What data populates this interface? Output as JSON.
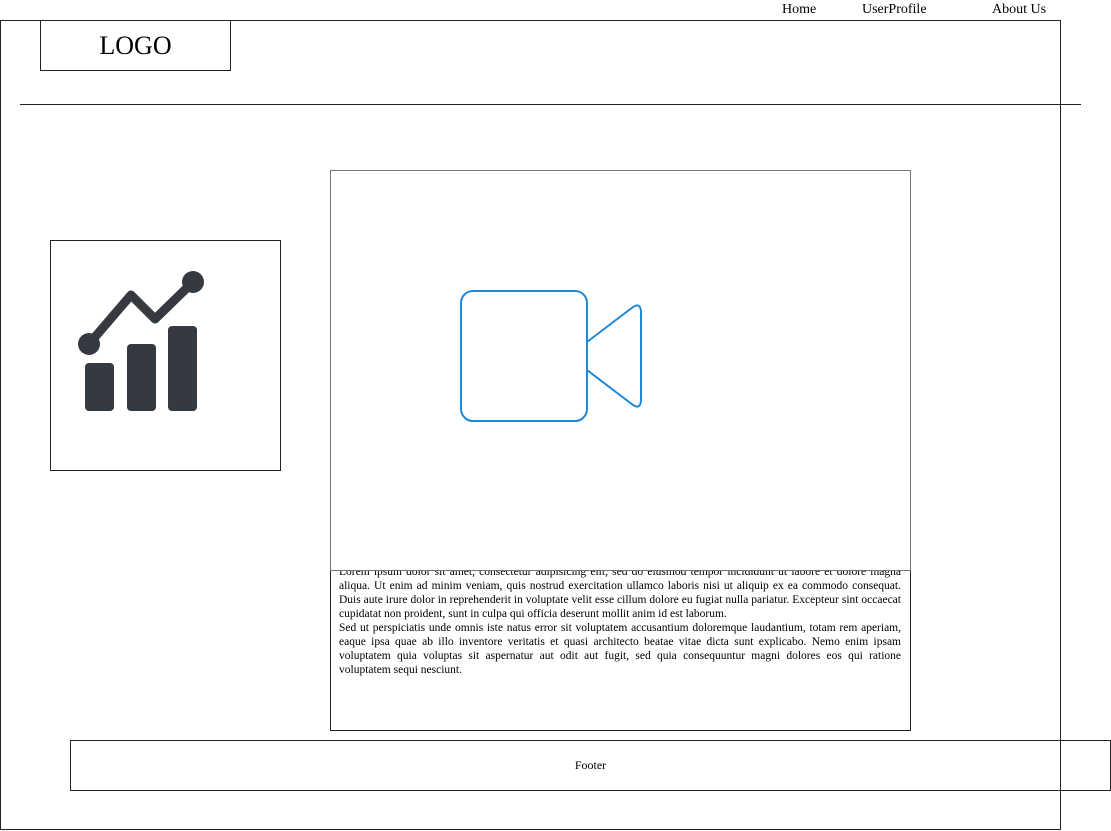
{
  "nav": {
    "home": "Home",
    "profile": "UserProfile",
    "about": "About Us"
  },
  "header": {
    "logo": "LOGO"
  },
  "main": {
    "chart_icon": "chart-growth-icon",
    "video_icon": "video-camera-icon",
    "paragraph_1": "Lorem ipsum dolor sit amet, consectetur adipisicing elit, sed do eiusmod tempor incididunt ut labore et dolore magna aliqua. Ut enim ad minim veniam, quis nostrud exercitation ullamco laboris nisi ut aliquip ex ea commodo consequat. Duis aute irure dolor in reprehenderit in voluptate velit esse cillum dolore eu fugiat nulla pariatur. Excepteur sint occaecat cupidatat non proident, sunt in culpa qui officia deserunt mollit anim id est laborum.",
    "paragraph_2": "Sed ut perspiciatis unde omnis iste natus error sit voluptatem accusantium doloremque laudantium, totam rem aperiam, eaque ipsa quae ab illo inventore veritatis et quasi architecto beatae vitae dicta sunt explicabo. Nemo enim ipsam voluptatem quia voluptas sit aspernatur aut odit aut fugit, sed quia consequuntur magni dolores eos qui ratione voluptatem sequi nesciunt."
  },
  "footer": {
    "label": "Footer"
  },
  "colors": {
    "video_icon_stroke": "#1f87d8",
    "chart_icon_fill": "#343a40"
  }
}
